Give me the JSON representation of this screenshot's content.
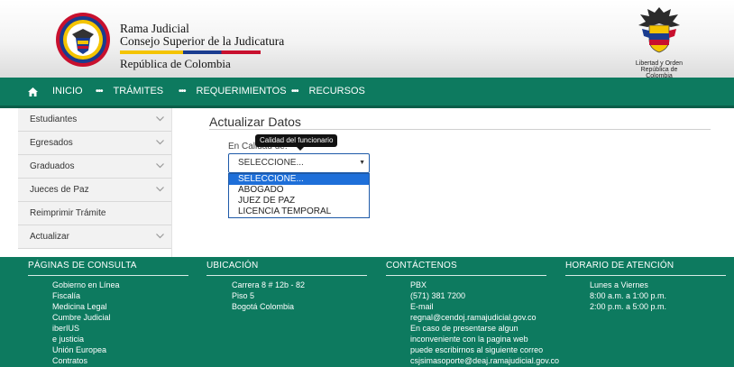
{
  "header": {
    "brand_line1": "Rama Judicial",
    "brand_line2": "Consejo Superior de la Judicatura",
    "brand_line3": "República de Colombia",
    "coat_caption1": "Libertad y Orden",
    "coat_caption2": "República de Colombia"
  },
  "nav": {
    "home": "INICIO",
    "tramites": "TRÁMITES",
    "requerimientos": "REQUERIMIENTOS",
    "recursos": "RECURSOS"
  },
  "sidebar": {
    "items": [
      {
        "label": "Estudiantes",
        "has_chevron": true
      },
      {
        "label": "Egresados",
        "has_chevron": true
      },
      {
        "label": "Graduados",
        "has_chevron": true
      },
      {
        "label": "Jueces de Paz",
        "has_chevron": true
      },
      {
        "label": "Reimprimir Trámite",
        "has_chevron": false
      },
      {
        "label": "Actualizar",
        "has_chevron": true
      }
    ]
  },
  "main": {
    "title": "Actualizar Datos",
    "field_label": "En Calidad de:",
    "tooltip": "Calidad del funcionario",
    "select_value": "SELECCIONE...",
    "options": [
      "SELECCIONE...",
      "ABOGADO",
      "JUEZ DE PAZ",
      "LICENCIA TEMPORAL"
    ]
  },
  "footer": {
    "paginas": {
      "heading": "PÁGINAS DE CONSULTA",
      "items": [
        "Gobierno en Línea",
        "Fiscalía",
        "Medicina Legal",
        "Cumbre Judicial",
        "iberIUS",
        "e justicia",
        "Unión Europea",
        "Contratos"
      ]
    },
    "ubicacion": {
      "heading": "UBICACIÓN",
      "items": [
        "Carrera 8 # 12b - 82",
        "Piso 5",
        "Bogotá Colombia"
      ]
    },
    "contactenos": {
      "heading": "CONTÁCTENOS",
      "items": [
        "PBX",
        "(571) 381 7200",
        "E-mail",
        "regnal@cendoj.ramajudicial.gov.co",
        "En caso de presentarse algun",
        "inconveniente con la pagina web",
        "puede escribirnos al siguiente correo",
        "csjsimasoporte@deaj.ramajudicial.gov.co"
      ]
    },
    "horario": {
      "heading": "HORARIO DE ATENCIÓN",
      "items": [
        "Lunes a Viernes",
        "8:00 a.m. a 1:00 p.m.",
        "2:00 p.m. a 5:00 p.m."
      ]
    }
  },
  "colors": {
    "primary_green": "#0d7a5f",
    "select_blue": "#1e6fd9"
  }
}
